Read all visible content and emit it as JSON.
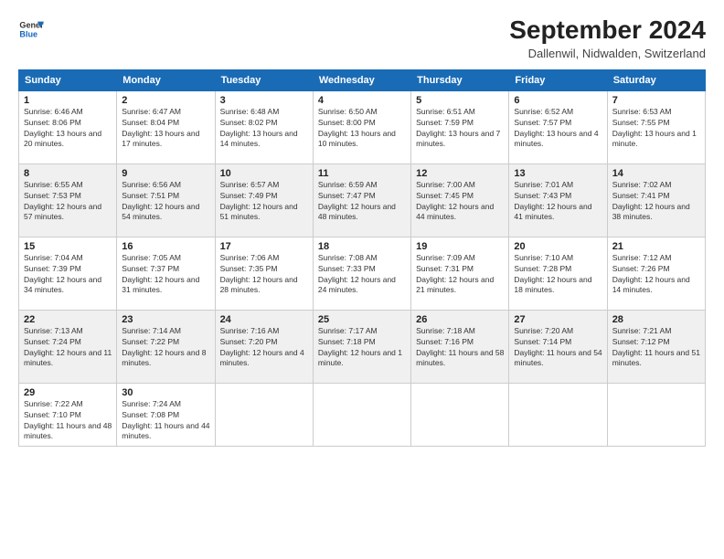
{
  "header": {
    "logo_line1": "General",
    "logo_line2": "Blue",
    "month": "September 2024",
    "location": "Dallenwil, Nidwalden, Switzerland"
  },
  "days_of_week": [
    "Sunday",
    "Monday",
    "Tuesday",
    "Wednesday",
    "Thursday",
    "Friday",
    "Saturday"
  ],
  "weeks": [
    [
      {
        "day": "1",
        "sunrise": "6:46 AM",
        "sunset": "8:06 PM",
        "daylight": "13 hours and 20 minutes."
      },
      {
        "day": "2",
        "sunrise": "6:47 AM",
        "sunset": "8:04 PM",
        "daylight": "13 hours and 17 minutes."
      },
      {
        "day": "3",
        "sunrise": "6:48 AM",
        "sunset": "8:02 PM",
        "daylight": "13 hours and 14 minutes."
      },
      {
        "day": "4",
        "sunrise": "6:50 AM",
        "sunset": "8:00 PM",
        "daylight": "13 hours and 10 minutes."
      },
      {
        "day": "5",
        "sunrise": "6:51 AM",
        "sunset": "7:59 PM",
        "daylight": "13 hours and 7 minutes."
      },
      {
        "day": "6",
        "sunrise": "6:52 AM",
        "sunset": "7:57 PM",
        "daylight": "13 hours and 4 minutes."
      },
      {
        "day": "7",
        "sunrise": "6:53 AM",
        "sunset": "7:55 PM",
        "daylight": "13 hours and 1 minute."
      }
    ],
    [
      {
        "day": "8",
        "sunrise": "6:55 AM",
        "sunset": "7:53 PM",
        "daylight": "12 hours and 57 minutes."
      },
      {
        "day": "9",
        "sunrise": "6:56 AM",
        "sunset": "7:51 PM",
        "daylight": "12 hours and 54 minutes."
      },
      {
        "day": "10",
        "sunrise": "6:57 AM",
        "sunset": "7:49 PM",
        "daylight": "12 hours and 51 minutes."
      },
      {
        "day": "11",
        "sunrise": "6:59 AM",
        "sunset": "7:47 PM",
        "daylight": "12 hours and 48 minutes."
      },
      {
        "day": "12",
        "sunrise": "7:00 AM",
        "sunset": "7:45 PM",
        "daylight": "12 hours and 44 minutes."
      },
      {
        "day": "13",
        "sunrise": "7:01 AM",
        "sunset": "7:43 PM",
        "daylight": "12 hours and 41 minutes."
      },
      {
        "day": "14",
        "sunrise": "7:02 AM",
        "sunset": "7:41 PM",
        "daylight": "12 hours and 38 minutes."
      }
    ],
    [
      {
        "day": "15",
        "sunrise": "7:04 AM",
        "sunset": "7:39 PM",
        "daylight": "12 hours and 34 minutes."
      },
      {
        "day": "16",
        "sunrise": "7:05 AM",
        "sunset": "7:37 PM",
        "daylight": "12 hours and 31 minutes."
      },
      {
        "day": "17",
        "sunrise": "7:06 AM",
        "sunset": "7:35 PM",
        "daylight": "12 hours and 28 minutes."
      },
      {
        "day": "18",
        "sunrise": "7:08 AM",
        "sunset": "7:33 PM",
        "daylight": "12 hours and 24 minutes."
      },
      {
        "day": "19",
        "sunrise": "7:09 AM",
        "sunset": "7:31 PM",
        "daylight": "12 hours and 21 minutes."
      },
      {
        "day": "20",
        "sunrise": "7:10 AM",
        "sunset": "7:28 PM",
        "daylight": "12 hours and 18 minutes."
      },
      {
        "day": "21",
        "sunrise": "7:12 AM",
        "sunset": "7:26 PM",
        "daylight": "12 hours and 14 minutes."
      }
    ],
    [
      {
        "day": "22",
        "sunrise": "7:13 AM",
        "sunset": "7:24 PM",
        "daylight": "12 hours and 11 minutes."
      },
      {
        "day": "23",
        "sunrise": "7:14 AM",
        "sunset": "7:22 PM",
        "daylight": "12 hours and 8 minutes."
      },
      {
        "day": "24",
        "sunrise": "7:16 AM",
        "sunset": "7:20 PM",
        "daylight": "12 hours and 4 minutes."
      },
      {
        "day": "25",
        "sunrise": "7:17 AM",
        "sunset": "7:18 PM",
        "daylight": "12 hours and 1 minute."
      },
      {
        "day": "26",
        "sunrise": "7:18 AM",
        "sunset": "7:16 PM",
        "daylight": "11 hours and 58 minutes."
      },
      {
        "day": "27",
        "sunrise": "7:20 AM",
        "sunset": "7:14 PM",
        "daylight": "11 hours and 54 minutes."
      },
      {
        "day": "28",
        "sunrise": "7:21 AM",
        "sunset": "7:12 PM",
        "daylight": "11 hours and 51 minutes."
      }
    ],
    [
      {
        "day": "29",
        "sunrise": "7:22 AM",
        "sunset": "7:10 PM",
        "daylight": "11 hours and 48 minutes."
      },
      {
        "day": "30",
        "sunrise": "7:24 AM",
        "sunset": "7:08 PM",
        "daylight": "11 hours and 44 minutes."
      },
      null,
      null,
      null,
      null,
      null
    ]
  ]
}
